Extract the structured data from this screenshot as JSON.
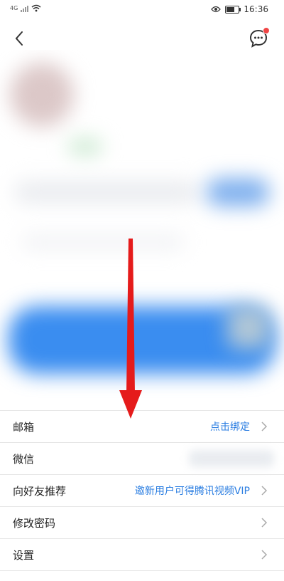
{
  "status_bar": {
    "signal_label": "4G",
    "time": "16:36"
  },
  "settings": [
    {
      "label": "邮箱",
      "value": "点击绑定",
      "chevron": true
    },
    {
      "label": "微信",
      "value": "",
      "chevron": false
    },
    {
      "label": "向好友推荐",
      "value": "邀新用户可得腾讯视频VIP",
      "chevron": true
    },
    {
      "label": "修改密码",
      "value": "",
      "chevron": true
    },
    {
      "label": "设置",
      "value": "",
      "chevron": true
    }
  ],
  "colors": {
    "accent": "#2a7de1",
    "annotation": "#e51b1b",
    "badge": "#f04545"
  },
  "icons": [
    "back-icon",
    "message-icon",
    "eye-icon",
    "battery-icon",
    "wifi-icon",
    "chevron-right-icon"
  ]
}
